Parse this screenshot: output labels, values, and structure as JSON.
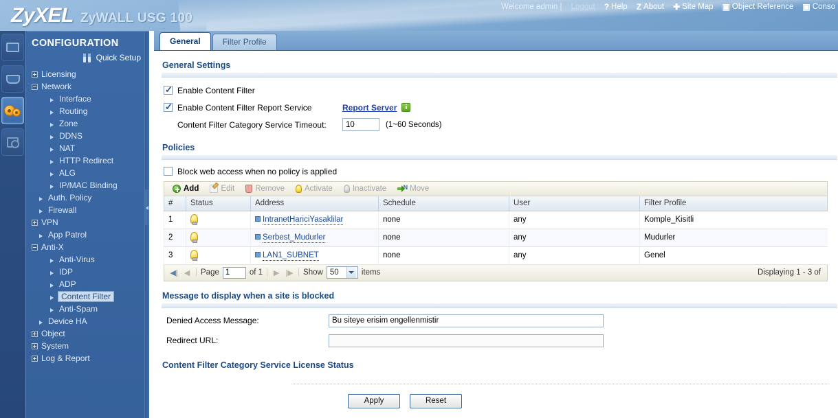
{
  "header": {
    "brand": "ZyXEL",
    "model": "ZyWALL USG 100",
    "welcome": "Welcome admin |",
    "logout": "Logout",
    "nav": [
      {
        "icon": "help-icon",
        "glyph": "?",
        "label": "Help"
      },
      {
        "icon": "about-icon",
        "glyph": "Z",
        "label": "About"
      },
      {
        "icon": "site-map-icon",
        "glyph": "✚",
        "label": "Site Map"
      },
      {
        "icon": "object-reference-icon",
        "glyph": "▣",
        "label": "Object Reference"
      },
      {
        "icon": "console-icon",
        "glyph": "▣",
        "label": "Conso"
      }
    ]
  },
  "rail": {
    "items": [
      {
        "name": "dashboard-icon",
        "active": false
      },
      {
        "name": "monitor-icon",
        "active": false
      },
      {
        "name": "configuration-gears-icon",
        "active": true
      },
      {
        "name": "maintenance-icon",
        "active": false
      }
    ]
  },
  "sidebar": {
    "title": "CONFIGURATION",
    "quick_setup": "Quick Setup",
    "tree": [
      {
        "label": "Licensing",
        "level": 0,
        "marker": "plus"
      },
      {
        "label": "Network",
        "level": 0,
        "marker": "minus"
      },
      {
        "label": "Interface",
        "level": 2,
        "marker": "arrow"
      },
      {
        "label": "Routing",
        "level": 2,
        "marker": "arrow"
      },
      {
        "label": "Zone",
        "level": 2,
        "marker": "arrow"
      },
      {
        "label": "DDNS",
        "level": 2,
        "marker": "arrow"
      },
      {
        "label": "NAT",
        "level": 2,
        "marker": "arrow"
      },
      {
        "label": "HTTP Redirect",
        "level": 2,
        "marker": "arrow"
      },
      {
        "label": "ALG",
        "level": 2,
        "marker": "arrow"
      },
      {
        "label": "IP/MAC Binding",
        "level": 2,
        "marker": "arrow"
      },
      {
        "label": "Auth. Policy",
        "level": 1,
        "marker": "arrow"
      },
      {
        "label": "Firewall",
        "level": 1,
        "marker": "arrow"
      },
      {
        "label": "VPN",
        "level": 0,
        "marker": "plus"
      },
      {
        "label": "App Patrol",
        "level": 1,
        "marker": "arrow"
      },
      {
        "label": "Anti-X",
        "level": 0,
        "marker": "minus"
      },
      {
        "label": "Anti-Virus",
        "level": 2,
        "marker": "arrow"
      },
      {
        "label": "IDP",
        "level": 2,
        "marker": "arrow"
      },
      {
        "label": "ADP",
        "level": 2,
        "marker": "arrow"
      },
      {
        "label": "Content Filter",
        "level": 2,
        "marker": "arrow",
        "selected": true
      },
      {
        "label": "Anti-Spam",
        "level": 2,
        "marker": "arrow"
      },
      {
        "label": "Device HA",
        "level": 1,
        "marker": "arrow"
      },
      {
        "label": "Object",
        "level": 0,
        "marker": "plus"
      },
      {
        "label": "System",
        "level": 0,
        "marker": "plus"
      },
      {
        "label": "Log & Report",
        "level": 0,
        "marker": "plus"
      }
    ]
  },
  "tabs": [
    {
      "label": "General",
      "active": true
    },
    {
      "label": "Filter Profile",
      "active": false
    }
  ],
  "general_settings": {
    "title": "General Settings",
    "enable_content_filter": {
      "label": "Enable Content Filter",
      "checked": true
    },
    "enable_report_service": {
      "label": "Enable Content Filter Report Service",
      "checked": true
    },
    "report_server_link": "Report Server",
    "info_badge": "i",
    "timeout_label": "Content Filter Category Service Timeout:",
    "timeout_value": "10",
    "timeout_hint": "(1~60 Seconds)"
  },
  "policies": {
    "title": "Policies",
    "block_checkbox": {
      "label": "Block web access when no policy is applied",
      "checked": false
    },
    "toolbar": [
      {
        "label": "Add",
        "icon": "add-icon",
        "enabled": true
      },
      {
        "label": "Edit",
        "icon": "edit-icon",
        "enabled": false
      },
      {
        "label": "Remove",
        "icon": "remove-trash-icon",
        "enabled": false
      },
      {
        "label": "Activate",
        "icon": "activate-bulb-icon",
        "enabled": false
      },
      {
        "label": "Inactivate",
        "icon": "inactivate-bulb-icon",
        "enabled": false
      },
      {
        "label": "Move",
        "icon": "move-arrow-icon",
        "enabled": false
      }
    ],
    "columns": [
      "#",
      "Status",
      "Address",
      "Schedule",
      "User",
      "Filter Profile"
    ],
    "rows": [
      {
        "num": "1",
        "status": "active",
        "address": "IntranetHariciYasaklilar",
        "schedule": "none",
        "user": "any",
        "profile": "Komple_Kisitli"
      },
      {
        "num": "2",
        "status": "active",
        "address": "Serbest_Mudurler",
        "schedule": "none",
        "user": "any",
        "profile": "Mudurler"
      },
      {
        "num": "3",
        "status": "active",
        "address": "LAN1_SUBNET",
        "schedule": "none",
        "user": "any",
        "profile": "Genel"
      }
    ],
    "pager": {
      "page_label": "Page",
      "page_value": "1",
      "of_label": "of 1",
      "show_label": "Show",
      "show_value": "50",
      "items_label": "items",
      "displaying": "Displaying 1 - 3 of"
    }
  },
  "blocked_message": {
    "title": "Message to display when a site is blocked",
    "denied_label": "Denied Access Message:",
    "denied_value": "Bu siteye erisim engellenmistir",
    "redirect_label": "Redirect URL:",
    "redirect_value": ""
  },
  "license": {
    "title": "Content Filter Category Service License Status"
  },
  "actions": {
    "apply": "Apply",
    "reset": "Reset"
  }
}
